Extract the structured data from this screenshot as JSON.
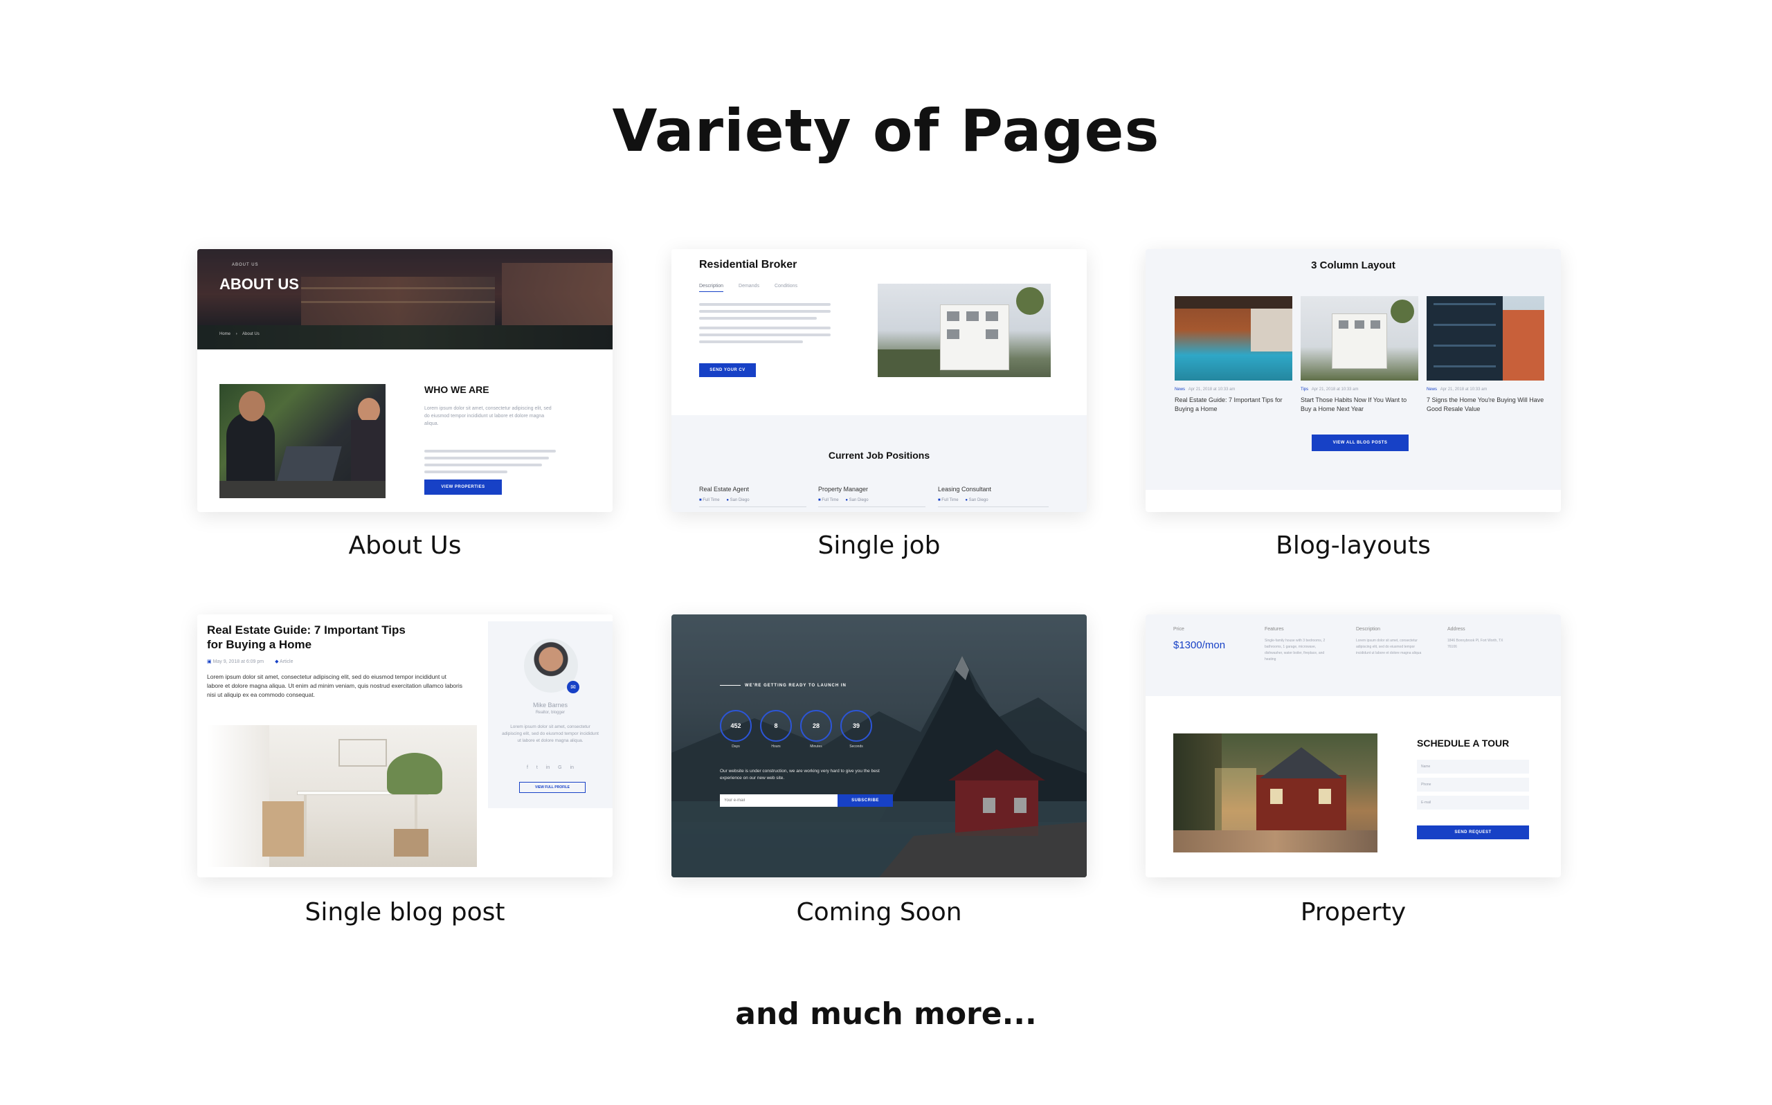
{
  "heading": "Variety of Pages",
  "footer": "and much more...",
  "accent": "#1741c6",
  "cards": {
    "about": {
      "caption": "About Us",
      "eyebrow": "ABOUT US",
      "hero_title": "ABOUT US",
      "crumb_home": "Home",
      "crumb_current": "About Us",
      "section_title": "WHO WE ARE",
      "body": "Lorem ipsum dolor sit amet, consectetur adipiscing elit, sed do eiusmod tempor incididunt ut labore et dolore magna aliqua.",
      "button": "VIEW PROPERTIES"
    },
    "job": {
      "caption": "Single job",
      "title": "Residential Broker",
      "tabs": [
        "Description",
        "Demands",
        "Conditions"
      ],
      "button": "SEND YOUR CV",
      "positions_title": "Current Job Positions",
      "positions": [
        {
          "title": "Real Estate Agent",
          "type": "Full Time",
          "location": "San Diego"
        },
        {
          "title": "Property Manager",
          "type": "Full Time",
          "location": "San Diego"
        },
        {
          "title": "Leasing Consultant",
          "type": "Full Time",
          "location": "San Diego"
        }
      ]
    },
    "blog": {
      "caption": "Blog-layouts",
      "title": "3 Column Layout",
      "posts": [
        {
          "tag": "News",
          "date": "Apr 21, 2018 at 10:33 am",
          "title": "Real Estate Guide: 7 Important Tips for Buying a Home"
        },
        {
          "tag": "Tips",
          "date": "Apr 21, 2018 at 10:33 am",
          "title": "Start Those Habits Now If You Want to Buy a Home Next Year"
        },
        {
          "tag": "News",
          "date": "Apr 21, 2018 at 10:33 am",
          "title": "7 Signs the Home You're Buying Will Have Good Resale Value"
        }
      ],
      "button": "VIEW ALL BLOG POSTS"
    },
    "post": {
      "caption": "Single blog post",
      "title": "Real Estate Guide: 7 Important Tips for Buying a Home",
      "date": "May 9, 2018 at 6:09 pm",
      "category": "Article",
      "body": "Lorem ipsum dolor sit amet, consectetur adipiscing elit, sed do eiusmod tempor incididunt ut labore et dolore magna aliqua. Ut enim ad minim veniam, quis nostrud exercitation ullamco laboris nisi ut aliquip ex ea commodo consequat.",
      "author_name": "Mike Barnes",
      "author_role": "Realtor, blogger",
      "author_bio": "Lorem ipsum dolor sit amet, consectetur adipiscing elit, sed do eiusmod tempor incididunt ut labore et dolore magna aliqua.",
      "social": [
        "f",
        "t",
        "in",
        "G",
        "in"
      ],
      "profile_button": "VIEW FULL PROFILE"
    },
    "soon": {
      "caption": "Coming Soon",
      "eyebrow": "WE'RE GETTING READY TO LAUNCH IN",
      "counters": [
        {
          "value": "452",
          "label": "Days"
        },
        {
          "value": "8",
          "label": "Hours"
        },
        {
          "value": "28",
          "label": "Minutes"
        },
        {
          "value": "39",
          "label": "Seconds"
        }
      ],
      "message": "Our website is under construction, we are working very hard to give you the best experience on our new web site.",
      "email_placeholder": "Your e-mail",
      "button": "SUBSCRIBE"
    },
    "property": {
      "caption": "Property",
      "price_label": "Price",
      "price": "$1300/mon",
      "features_label": "Features",
      "features_text": "Single-family house with 3 bedrooms, 2 bathrooms, 1 garage, microwave, dishwasher, water boiler, fireplace, and heating",
      "description_label": "Description",
      "description_text": "Lorem ipsum dolor sit amet, consectetur adipiscing elit, sed do eiusmod tempor incididunt ut labore et dolore magna aliqua",
      "address_label": "Address",
      "address_text": "1846 Bonnybrook Pl, Fort Worth, TX 76106",
      "form_title": "SCHEDULE A TOUR",
      "fields": [
        "Name",
        "Phone",
        "E-mail"
      ],
      "button": "SEND REQUEST"
    }
  }
}
